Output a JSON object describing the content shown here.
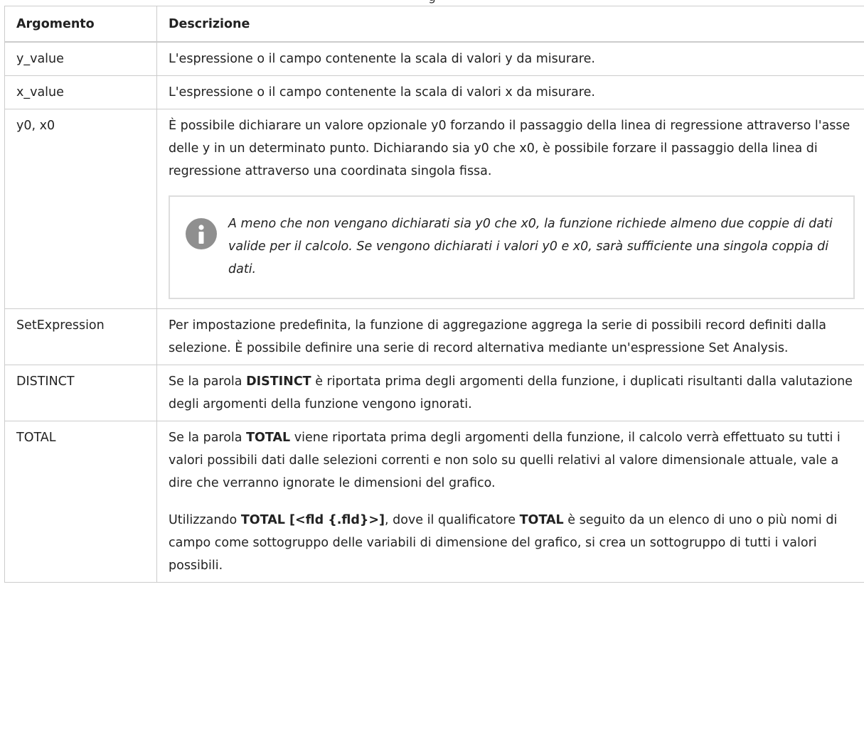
{
  "caption": "g",
  "table": {
    "headers": [
      "Argomento",
      "Descrizione"
    ],
    "rows": [
      {
        "arg": "y_value",
        "desc": "L'espressione o il campo contenente la scala di valori y da misurare."
      },
      {
        "arg": "x_value",
        "desc": "L'espressione o il campo contenente la scala di valori x da misurare."
      },
      {
        "arg": "y0, x0",
        "desc": "È possibile dichiarare un valore opzionale y0 forzando il passaggio della linea di regressione attraverso l'asse delle y in un determinato punto. Dichiarando sia y0 che x0, è possibile forzare il passaggio della linea di regressione attraverso una coordinata singola fissa.",
        "note": "A meno che non vengano dichiarati sia y0 che x0, la funzione richiede almeno due coppie di dati valide per il calcolo. Se vengono dichiarati i valori y0 e x0, sarà sufficiente una singola coppia di dati.",
        "note_icon": "info-icon"
      },
      {
        "arg": "SetExpression",
        "desc": "Per impostazione predefinita, la funzione di aggregazione aggrega la serie di possibili record definiti dalla selezione. È possibile definire una serie di record alternativa mediante un'espressione Set Analysis."
      },
      {
        "arg": "DISTINCT",
        "desc_pre": "Se la parola ",
        "desc_bold": "DISTINCT",
        "desc_post": " è riportata prima degli argomenti della funzione, i duplicati risultanti dalla valutazione degli argomenti della funzione vengono ignorati."
      },
      {
        "arg": "TOTAL",
        "p1_pre": "Se la parola ",
        "p1_bold": "TOTAL",
        "p1_post": " viene riportata prima degli argomenti della funzione, il calcolo verrà effettuato su tutti i valori possibili dati dalle selezioni correnti e non solo su quelli relativi al valore dimensionale attuale, vale a dire che verranno ignorate le dimensioni del grafico.",
        "p2_pre": "Utilizzando ",
        "p2_bold1": "TOTAL [<fld {.fld}>]",
        "p2_mid": ", dove il qualificatore ",
        "p2_bold2": "TOTAL",
        "p2_post": " è seguito da un elenco di uno o più nomi di campo come sottogruppo delle variabili di dimensione del grafico, si crea un sottogruppo di tutti i valori possibili."
      }
    ]
  }
}
